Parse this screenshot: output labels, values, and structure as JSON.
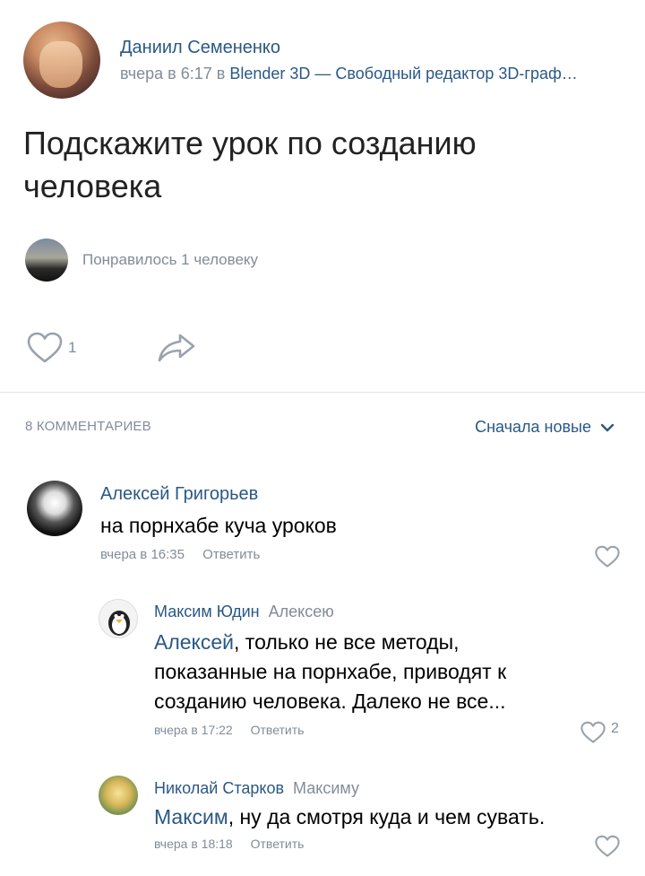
{
  "post": {
    "author": "Даниил Семененко",
    "time": "вчера в 6:17 в",
    "group": "Blender 3D — Свободный редактор 3D-граф…",
    "text": "Подскажите урок по созданию человека",
    "likes_text": "Понравилось 1 человеку",
    "like_count": "1"
  },
  "comments_header": {
    "count_label": "8 КОММЕНТАРИЕВ",
    "sort_label": "Сначала новые"
  },
  "comments": [
    {
      "author": "Алексей Григорьев",
      "reply_to": "",
      "mention": "",
      "text": "на порнхабе куча уроков",
      "time": "вчера в 16:35",
      "reply_label": "Ответить",
      "likes": ""
    },
    {
      "author": "Максим Юдин",
      "reply_to": "Алексею",
      "mention": "Алексей",
      "text": ", только не все методы, показанные на порнхабе, приводят к созданию человека. Далеко не все...",
      "time": "вчера в 17:22",
      "reply_label": "Ответить",
      "likes": "2"
    },
    {
      "author": "Николай Старков",
      "reply_to": "Максиму",
      "mention": "Максим",
      "text": ", ну да смотря куда и чем сувать.",
      "time": "вчера в 18:18",
      "reply_label": "Ответить",
      "likes": ""
    }
  ],
  "icons": {
    "heart": "heart-icon",
    "share": "share-icon",
    "chevron": "chevron-down-icon"
  },
  "colors": {
    "link": "#2a5885",
    "secondary": "#818c99",
    "divider": "#e1e3e6"
  }
}
